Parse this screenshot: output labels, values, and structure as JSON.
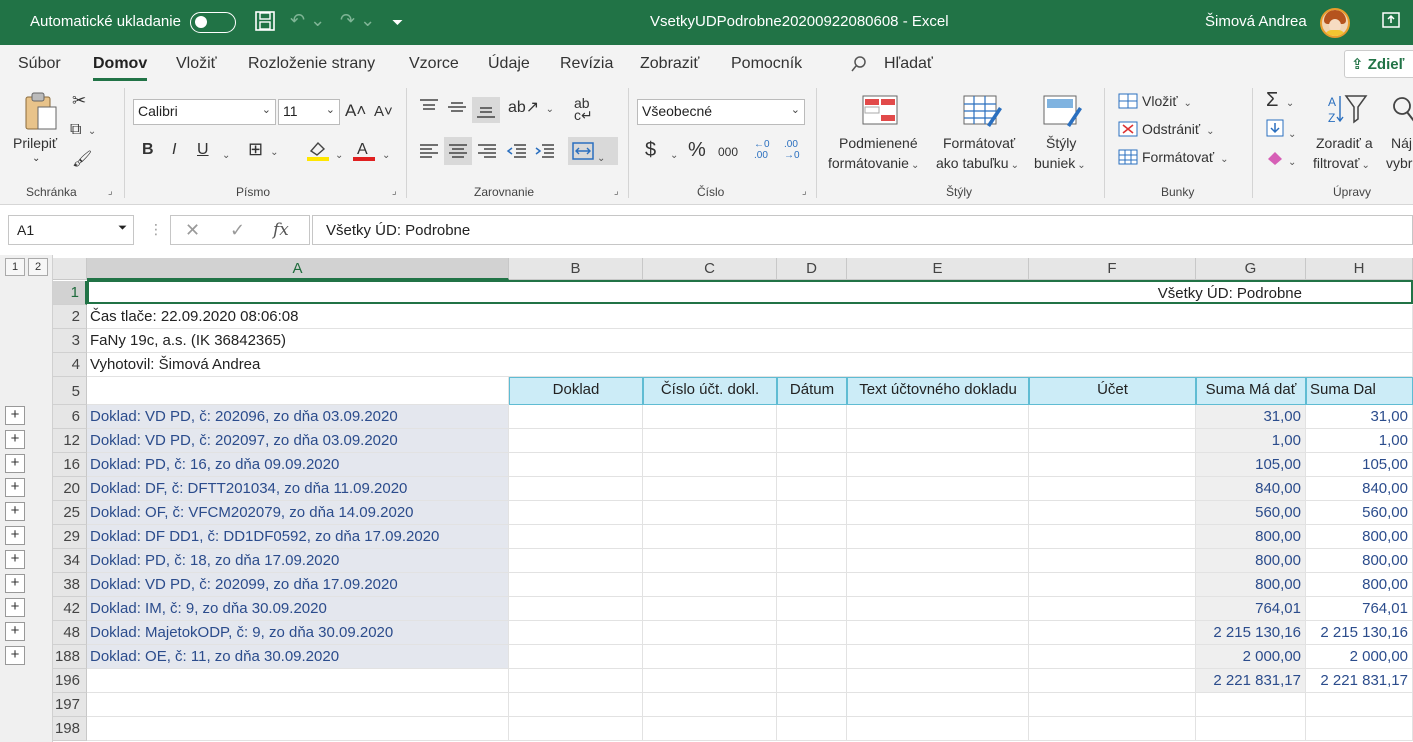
{
  "titlebar": {
    "autosave_label": "Automatické ukladanie",
    "document_title": "VsetkyUDPodrobne20200922080608  -  Excel",
    "user_name": "Šimová Andrea"
  },
  "menu": {
    "tabs": [
      "Súbor",
      "Domov",
      "Vložiť",
      "Rozloženie strany",
      "Vzorce",
      "Údaje",
      "Revízia",
      "Zobraziť",
      "Pomocník"
    ],
    "active_tab": "Domov",
    "search_label": "Hľadať",
    "share_label": "Zdieľ"
  },
  "ribbon": {
    "clipboard": {
      "paste_label": "Prilepiť",
      "group_label": "Schránka"
    },
    "font": {
      "font_name": "Calibri",
      "font_size": "11",
      "group_label": "Písmo",
      "bold": "B",
      "italic": "I",
      "underline": "U"
    },
    "alignment": {
      "group_label": "Zarovnanie"
    },
    "number": {
      "format": "Všeobecné",
      "group_label": "Číslo",
      "currency": "$",
      "percent": "%",
      "thousands": "000"
    },
    "styles": {
      "conditional_label1": "Podmienené",
      "conditional_label2": "formátovanie",
      "table_label1": "Formátovať",
      "table_label2": "ako tabuľku",
      "cell_styles_label1": "Štýly",
      "cell_styles_label2": "buniek",
      "group_label": "Štýly"
    },
    "cells": {
      "insert": "Vložiť",
      "delete": "Odstrániť",
      "format": "Formátovať",
      "group_label": "Bunky"
    },
    "editing": {
      "sort_label1": "Zoradiť a",
      "sort_label2": "filtrovať",
      "find_label1": "Náj",
      "find_label2": "vybr",
      "group_label": "Úpravy"
    }
  },
  "formula_bar": {
    "name_box": "A1",
    "fx": "fx",
    "formula": "Všetky ÚD: Podrobne"
  },
  "outline_levels": [
    "1",
    "2"
  ],
  "columns": [
    "A",
    "B",
    "C",
    "D",
    "E",
    "F",
    "G",
    "H"
  ],
  "sheet": {
    "title_cell": "Všetky ÚD: Podrobne",
    "print_time": "Čas tlače: 22.09.2020 08:06:08",
    "company": "FaNy 19c, a.s. (IK 36842365)",
    "author": "Vyhotovil: Šimová Andrea",
    "headers": [
      "Doklad",
      "Číslo účt. dokl.",
      "Dátum",
      "Text účtovného dokladu",
      "Účet",
      "Suma Má dať",
      "Suma Dal"
    ],
    "group_rows": [
      {
        "row": "6",
        "label": "Doklad: VD PD, č: 202096, zo dňa 03.09.2020",
        "ma_dat": "31,00",
        "dal": "31,00"
      },
      {
        "row": "12",
        "label": "Doklad: VD PD, č: 202097, zo dňa 03.09.2020",
        "ma_dat": "1,00",
        "dal": "1,00"
      },
      {
        "row": "16",
        "label": "Doklad: PD, č: 16, zo dňa 09.09.2020",
        "ma_dat": "105,00",
        "dal": "105,00"
      },
      {
        "row": "20",
        "label": "Doklad: DF, č: DFTT201034, zo dňa 11.09.2020",
        "ma_dat": "840,00",
        "dal": "840,00"
      },
      {
        "row": "25",
        "label": "Doklad: OF, č: VFCM202079, zo dňa 14.09.2020",
        "ma_dat": "560,00",
        "dal": "560,00"
      },
      {
        "row": "29",
        "label": "Doklad: DF DD1, č: DD1DF0592, zo dňa 17.09.2020",
        "ma_dat": "800,00",
        "dal": "800,00"
      },
      {
        "row": "34",
        "label": "Doklad: PD, č: 18, zo dňa 17.09.2020",
        "ma_dat": "800,00",
        "dal": "800,00"
      },
      {
        "row": "38",
        "label": "Doklad: VD PD, č: 202099, zo dňa 17.09.2020",
        "ma_dat": "800,00",
        "dal": "800,00"
      },
      {
        "row": "42",
        "label": "Doklad: IM, č: 9, zo dňa 30.09.2020",
        "ma_dat": "764,01",
        "dal": "764,01"
      },
      {
        "row": "48",
        "label": "Doklad: MajetokODP, č: 9, zo dňa 30.09.2020",
        "ma_dat": "2 215 130,16",
        "dal": "2 215 130,16"
      },
      {
        "row": "188",
        "label": "Doklad: OE, č: 11, zo dňa 30.09.2020",
        "ma_dat": "2 000,00",
        "dal": "2 000,00"
      }
    ],
    "total_row": {
      "row": "196",
      "ma_dat": "2 221 831,17",
      "dal": "2 221 831,17"
    },
    "row_numbers_top": [
      "1",
      "2",
      "3",
      "4",
      "5"
    ],
    "row_numbers_bottom": [
      "197",
      "198"
    ]
  }
}
